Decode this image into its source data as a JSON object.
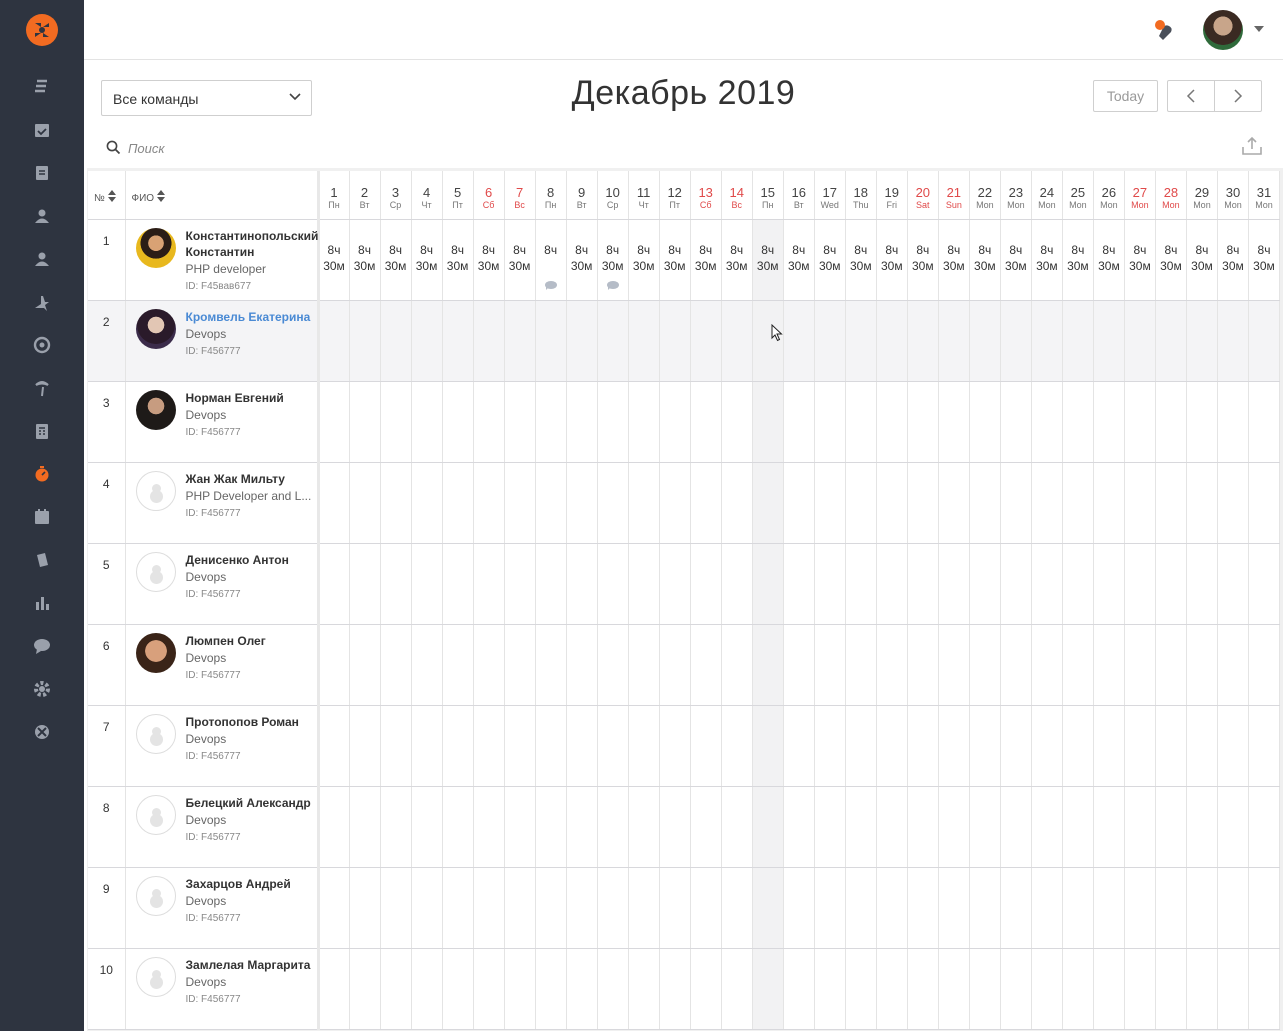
{
  "app": {
    "sidebar": [
      {
        "icon": "logo-icon"
      },
      {
        "icon": "tasks-icon"
      },
      {
        "icon": "calendar-check-icon"
      },
      {
        "icon": "document-icon"
      },
      {
        "icon": "user-icon"
      },
      {
        "icon": "user-icon"
      },
      {
        "icon": "plane-icon"
      },
      {
        "icon": "target-icon"
      },
      {
        "icon": "palm-icon"
      },
      {
        "icon": "calculator-icon"
      },
      {
        "icon": "timer-icon"
      },
      {
        "icon": "calendar-icon"
      },
      {
        "icon": "files-icon"
      },
      {
        "icon": "bar-chart-icon"
      },
      {
        "icon": "chat-icon"
      },
      {
        "icon": "gear-icon"
      },
      {
        "icon": "help-icon"
      }
    ],
    "active_color": "#f26b21"
  },
  "toolbar": {
    "team_select": "Все команды",
    "month_title": "Декабрь 2019",
    "today_label": "Today",
    "search_placeholder": "Поиск"
  },
  "table": {
    "num_header": "№",
    "name_header": "ФИО",
    "days": [
      {
        "d": "1",
        "w": "Пн",
        "we": false
      },
      {
        "d": "2",
        "w": "Вт",
        "we": false
      },
      {
        "d": "3",
        "w": "Ср",
        "we": false
      },
      {
        "d": "4",
        "w": "Чт",
        "we": false
      },
      {
        "d": "5",
        "w": "Пт",
        "we": false
      },
      {
        "d": "6",
        "w": "Сб",
        "we": true
      },
      {
        "d": "7",
        "w": "Вс",
        "we": true
      },
      {
        "d": "8",
        "w": "Пн",
        "we": false
      },
      {
        "d": "9",
        "w": "Вт",
        "we": false
      },
      {
        "d": "10",
        "w": "Ср",
        "we": false
      },
      {
        "d": "11",
        "w": "Чт",
        "we": false
      },
      {
        "d": "12",
        "w": "Пт",
        "we": false
      },
      {
        "d": "13",
        "w": "Сб",
        "we": true
      },
      {
        "d": "14",
        "w": "Вс",
        "we": true
      },
      {
        "d": "15",
        "w": "Пн",
        "we": false
      },
      {
        "d": "16",
        "w": "Вт",
        "we": false
      },
      {
        "d": "17",
        "w": "Wed",
        "we": false
      },
      {
        "d": "18",
        "w": "Thu",
        "we": false
      },
      {
        "d": "19",
        "w": "Fri",
        "we": false
      },
      {
        "d": "20",
        "w": "Sat",
        "we": true
      },
      {
        "d": "21",
        "w": "Sun",
        "we": true
      },
      {
        "d": "22",
        "w": "Mon",
        "we": false
      },
      {
        "d": "23",
        "w": "Mon",
        "we": false
      },
      {
        "d": "24",
        "w": "Mon",
        "we": false
      },
      {
        "d": "25",
        "w": "Mon",
        "we": false
      },
      {
        "d": "26",
        "w": "Mon",
        "we": false
      },
      {
        "d": "27",
        "w": "Mon",
        "we": true
      },
      {
        "d": "28",
        "w": "Mon",
        "we": true
      },
      {
        "d": "29",
        "w": "Mon",
        "we": false
      },
      {
        "d": "30",
        "w": "Mon",
        "we": false
      },
      {
        "d": "31",
        "w": "Mon",
        "we": false
      }
    ],
    "today_index": 14,
    "rows": [
      {
        "n": "1",
        "name": "Константинопольский Константин",
        "role": "PHP developer",
        "id": "ID: F45вав677",
        "avatar": "photo-yellow",
        "active": false,
        "hours": [
          "8ч 30м",
          "8ч 30м",
          "8ч 30м",
          "8ч 30м",
          "8ч 30м",
          "8ч 30м",
          "8ч 30м",
          "8ч",
          "8ч 30м",
          "8ч 30м",
          "8ч 30м",
          "8ч 30м",
          "8ч 30м",
          "8ч 30м",
          "8ч 30м",
          "8ч 30м",
          "8ч 30м",
          "8ч 30м",
          "8ч 30м",
          "8ч 30м",
          "8ч 30м",
          "8ч 30м",
          "8ч 30м",
          "8ч 30м",
          "8ч 30м",
          "8ч 30м",
          "8ч 30м",
          "8ч 30м",
          "8ч 30м",
          "8ч 30м",
          "8ч 30м"
        ],
        "comments": [
          7,
          9
        ]
      },
      {
        "n": "2",
        "name": "Кромвель Екатерина",
        "role": "Devops",
        "id": "ID: F456777",
        "avatar": "photo-dark",
        "active": true,
        "hours": [],
        "comments": []
      },
      {
        "n": "3",
        "name": "Норман Евгений",
        "role": "Devops",
        "id": "ID: F456777",
        "avatar": "photo-dark2",
        "active": false,
        "hours": [],
        "comments": []
      },
      {
        "n": "4",
        "name": "Жан Жак Мильту",
        "role": "PHP Developer and L...",
        "id": "ID: F456777",
        "avatar": "empty",
        "active": false,
        "hours": [],
        "comments": []
      },
      {
        "n": "5",
        "name": "Денисенко Антон",
        "role": "Devops",
        "id": "ID: F456777",
        "avatar": "empty",
        "active": false,
        "hours": [],
        "comments": []
      },
      {
        "n": "6",
        "name": "Люмпен Олег",
        "role": "Devops",
        "id": "ID: F456777",
        "avatar": "photo-face",
        "active": false,
        "hours": [],
        "comments": []
      },
      {
        "n": "7",
        "name": "Протопопов Роман",
        "role": "Devops",
        "id": "ID: F456777",
        "avatar": "empty",
        "active": false,
        "hours": [],
        "comments": []
      },
      {
        "n": "8",
        "name": "Белецкий Александр",
        "role": "Devops",
        "id": "ID: F456777",
        "avatar": "empty",
        "active": false,
        "hours": [],
        "comments": []
      },
      {
        "n": "9",
        "name": "Захарцов Андрей",
        "role": "Devops",
        "id": "ID: F456777",
        "avatar": "empty",
        "active": false,
        "hours": [],
        "comments": []
      },
      {
        "n": "10",
        "name": "Замлелая Маргарита",
        "role": "Devops",
        "id": "ID: F456777",
        "avatar": "empty",
        "active": false,
        "hours": [],
        "comments": []
      }
    ]
  }
}
